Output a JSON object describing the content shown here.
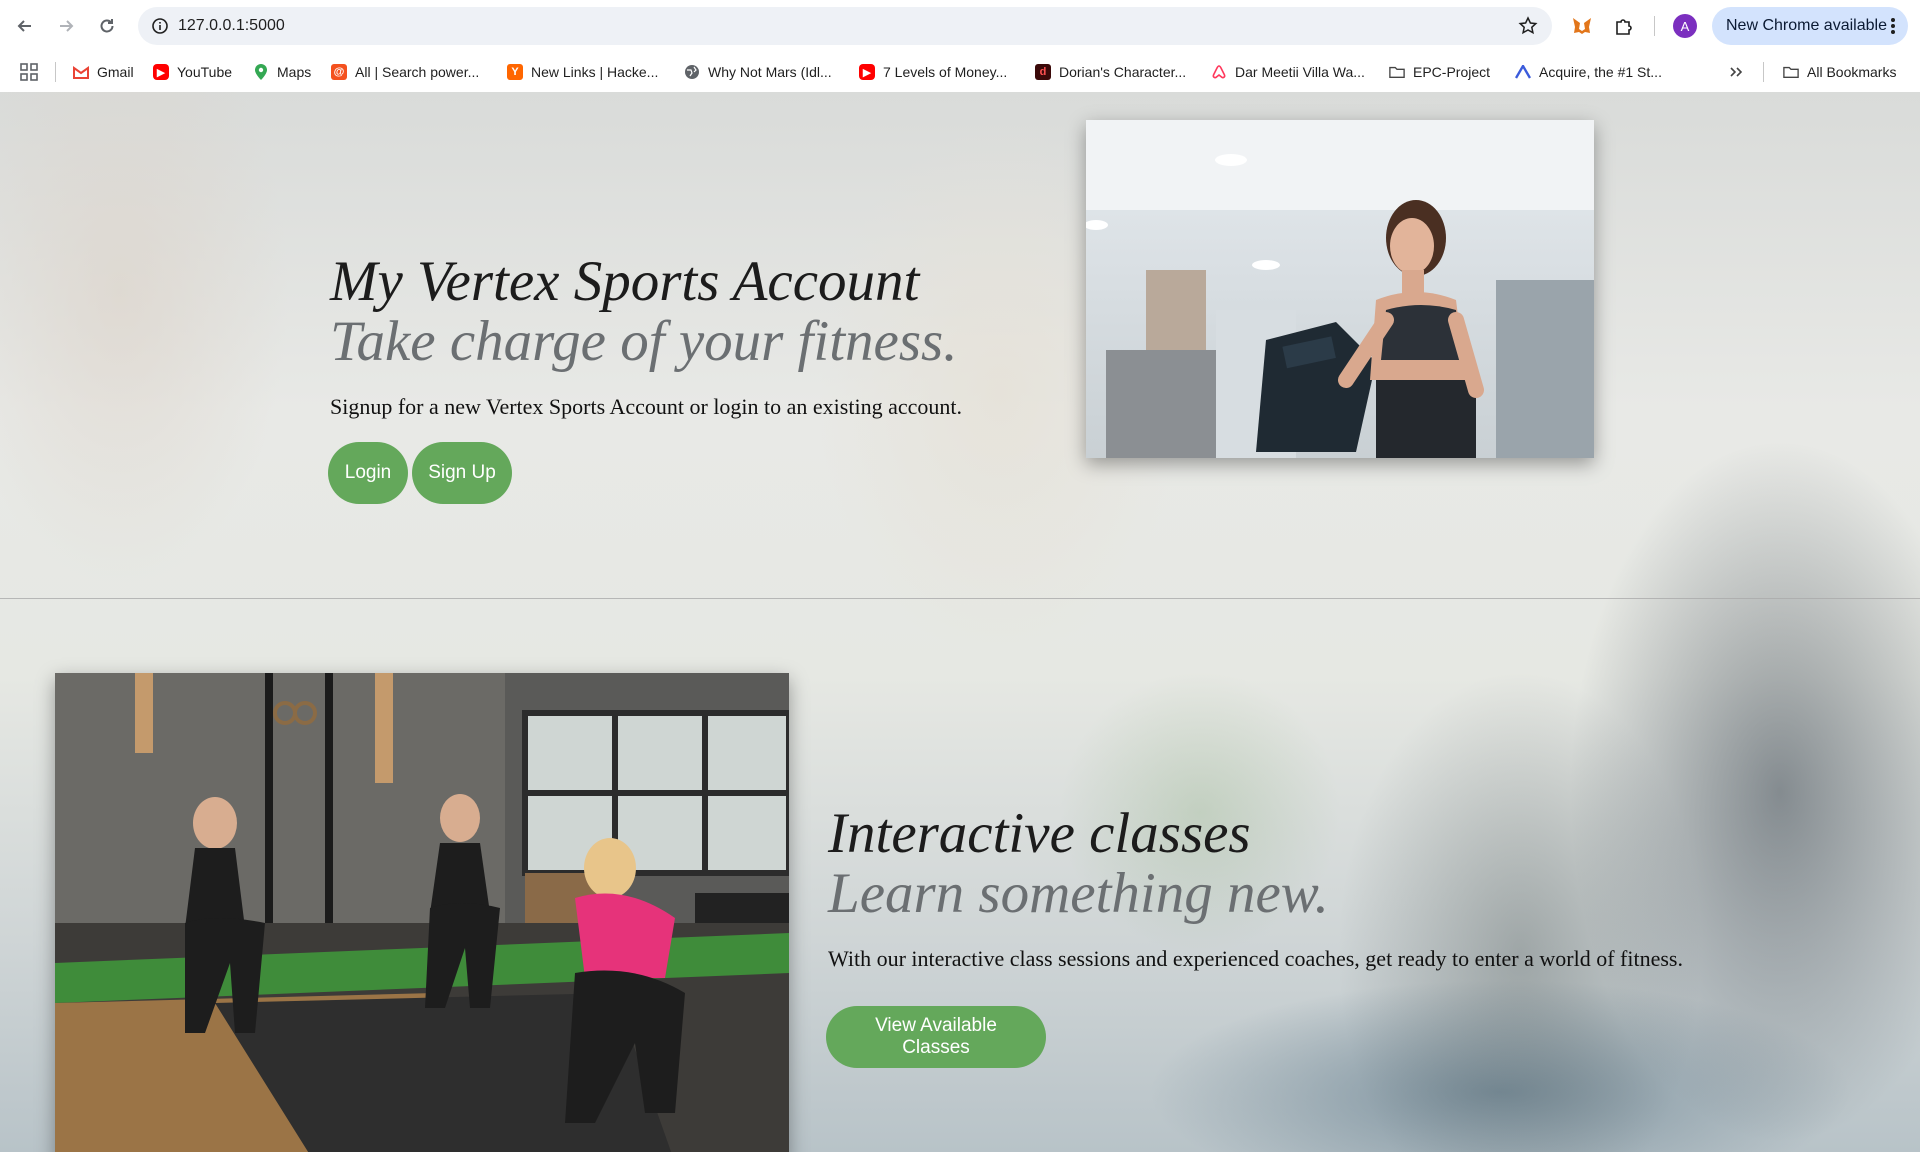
{
  "browser": {
    "url": "127.0.0.1:5000",
    "update_label": "New Chrome available",
    "profile_initial": "A",
    "bookmarks": [
      {
        "label": "Gmail",
        "icon": "gmail-icon",
        "color": "#ea4335"
      },
      {
        "label": "YouTube",
        "icon": "youtube-icon",
        "color": "#ff0000"
      },
      {
        "label": "Maps",
        "icon": "maps-icon",
        "color": "#34a853"
      },
      {
        "label": "All | Search power...",
        "icon": "search-power-icon",
        "color": "#f4511e"
      },
      {
        "label": "New Links | Hacke...",
        "icon": "hackernews-icon",
        "color": "#ff6600"
      },
      {
        "label": "Why Not Mars (Idl...",
        "icon": "globe-icon",
        "color": "#5f6368"
      },
      {
        "label": "7 Levels of Money...",
        "icon": "youtube-icon",
        "color": "#ff0000"
      },
      {
        "label": "Dorian's Character...",
        "icon": "dorian-icon",
        "color": "#c62828"
      },
      {
        "label": "Dar Meetii Villa Wa...",
        "icon": "airbnb-icon",
        "color": "#ff385c"
      },
      {
        "label": "EPC-Project",
        "icon": "folder-icon",
        "color": "#5f6368"
      },
      {
        "label": "Acquire, the #1 St...",
        "icon": "acquire-icon",
        "color": "#3b5bdb"
      }
    ],
    "all_bookmarks_label": "All Bookmarks"
  },
  "hero": {
    "title": "My Vertex Sports Account",
    "subtitle": "Take charge of your fitness.",
    "description": "Signup for a new Vertex Sports Account or login to an existing account.",
    "login_label": "Login",
    "signup_label": "Sign Up"
  },
  "classes": {
    "title": "Interactive classes",
    "subtitle": "Learn something new.",
    "description": "With our interactive class sessions and experienced coaches, get ready to enter a world of fitness.",
    "button_label": "View Available Classes"
  },
  "colors": {
    "accent_green": "#64a85b",
    "update_pill": "#d3e3fd",
    "avatar": "#7b2fbf"
  }
}
